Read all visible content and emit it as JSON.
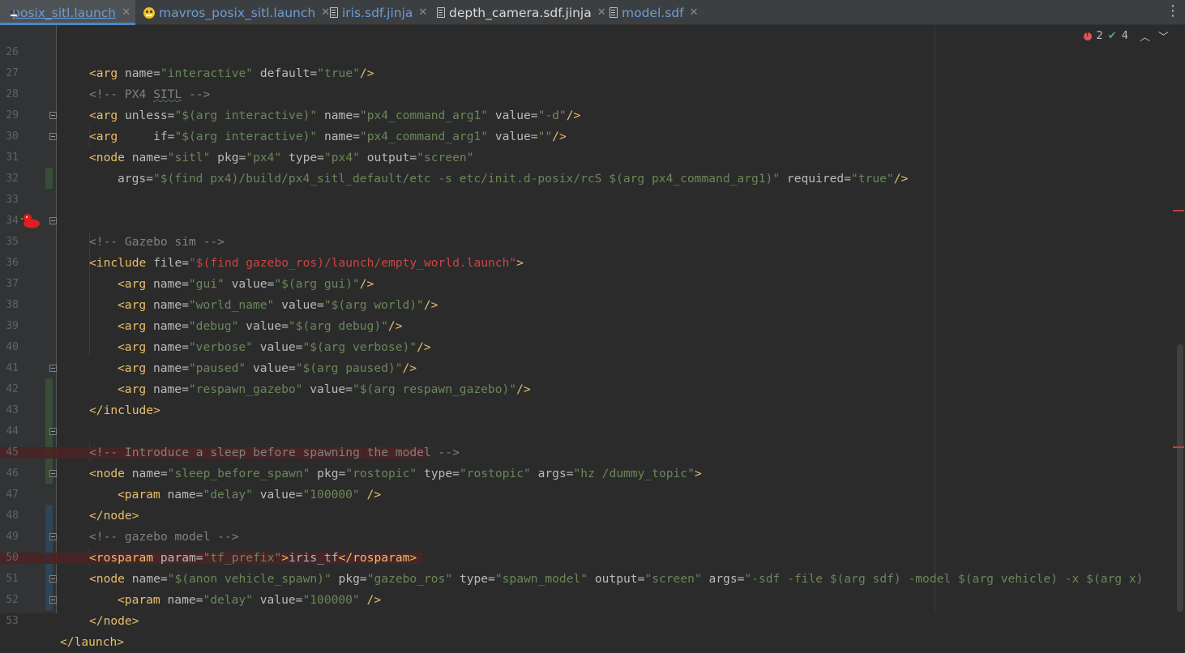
{
  "tabs": [
    {
      "label": "posix_sitl.launch",
      "icon": "ros-icon",
      "active": true
    },
    {
      "label": "mavros_posix_sitl.launch",
      "icon": "ros-icon"
    },
    {
      "label": "iris.sdf.jinja",
      "icon": "file-icon"
    },
    {
      "label": "depth_camera.sdf.jinja",
      "icon": "file-icon"
    },
    {
      "label": "model.sdf",
      "icon": "file-icon"
    }
  ],
  "status": {
    "errors": "2",
    "checks": "4"
  },
  "lines": [
    "26",
    "27",
    "28",
    "29",
    "30",
    "31",
    "32",
    "33",
    "34",
    "35",
    "36",
    "37",
    "38",
    "39",
    "40",
    "41",
    "42",
    "43",
    "44",
    "45",
    "46",
    "47",
    "48",
    "49",
    "50",
    "51",
    "52",
    "53"
  ],
  "code": {
    "l26": {
      "a": "<arg",
      "b": " name=",
      "c": "\"interactive\"",
      "d": " default=",
      "e": "\"true\"",
      "f": "/>"
    },
    "l27": {
      "a": "<!-- PX4 ",
      "b": "SITL",
      "c": " -->"
    },
    "l28": {
      "a": "<arg",
      "b": " unless=",
      "c": "\"$(arg interactive)\"",
      "d": " name=",
      "e": "\"px4_command_arg1\"",
      "f": " value=",
      "g": "\"-d\"",
      "h": "/>"
    },
    "l29": {
      "a": "<arg",
      "b": "     if=",
      "c": "\"$(arg interactive)\"",
      "d": " name=",
      "e": "\"px4_command_arg1\"",
      "f": " value=",
      "g": "\"\"",
      "h": "/>"
    },
    "l30": {
      "a": "<node",
      "b": " name=",
      "c": "\"sitl\"",
      "d": " pkg=",
      "e": "\"px4\"",
      "f": " type=",
      "g": "\"px4\"",
      "h": " output=",
      "i": "\"screen\""
    },
    "l31": {
      "a": "args=",
      "b": "\"$(find px4)/build/px4_sitl_default/etc -s etc/init.d-posix/rcS $(arg px4_command_arg1)\"",
      "c": " required=",
      "d": "\"true\"",
      "e": "/>"
    },
    "l34": {
      "a": "<!-- Gazebo sim -->"
    },
    "l35": {
      "a": "<include",
      "b": " file=",
      "c": "\"$(find gazebo_ros)/launch/empty_world.launch\"",
      "d": ">"
    },
    "l36": {
      "a": "<arg",
      "b": " name=",
      "c": "\"gui\"",
      "d": " value=",
      "e": "\"$(arg gui)\"",
      "f": "/>"
    },
    "l37": {
      "a": "<arg",
      "b": " name=",
      "c": "\"world_name\"",
      "d": " value=",
      "e": "\"$(arg world)\"",
      "f": "/>"
    },
    "l38": {
      "a": "<arg",
      "b": " name=",
      "c": "\"debug\"",
      "d": " value=",
      "e": "\"$(arg debug)\"",
      "f": "/>"
    },
    "l39": {
      "a": "<arg",
      "b": " name=",
      "c": "\"verbose\"",
      "d": " value=",
      "e": "\"$(arg verbose)\"",
      "f": "/>"
    },
    "l40": {
      "a": "<arg",
      "b": " name=",
      "c": "\"paused\"",
      "d": " value=",
      "e": "\"$(arg paused)\"",
      "f": "/>"
    },
    "l41": {
      "a": "<arg",
      "b": " name=",
      "c": "\"respawn_gazebo\"",
      "d": " value=",
      "e": "\"$(arg respawn_gazebo)\"",
      "f": "/>"
    },
    "l42": {
      "a": "</include>"
    },
    "l44": {
      "a": "<!-- Introduce a sleep before spawning the model -->"
    },
    "l45": {
      "a": "<node",
      "b": " name=",
      "c": "\"sleep_before_spawn\"",
      "d": " pkg=",
      "e": "\"rostopic\"",
      "f": " type=",
      "g": "\"rostopic\"",
      "h": " args=",
      "i": "\"hz /dummy_topic\"",
      "j": ">"
    },
    "l46": {
      "a": "<param",
      "b": " name=",
      "c": "\"delay\"",
      "d": " value=",
      "e": "\"100000\"",
      "f": " />"
    },
    "l47": {
      "a": "</node>"
    },
    "l48": {
      "a": "<!-- gazebo model -->"
    },
    "l49": {
      "a": "<rosparam",
      "b": " param=",
      "c": "\"tf_prefix\"",
      "d": ">",
      "e": "iris_tf",
      "f": "</rosparam>"
    },
    "l50": {
      "a": "<node",
      "b": " name=",
      "c": "\"$(anon vehicle_spawn)\"",
      "d": " pkg=",
      "e": "\"gazebo_ros\"",
      "f": " type=",
      "g": "\"spawn_model\"",
      "h": " output=",
      "i": "\"screen\"",
      "j": " args=",
      "k": "\"-sdf -file $(arg sdf) -model $(arg vehicle) -x $(arg x)"
    },
    "l51": {
      "a": "<param",
      "b": " name=",
      "c": "\"delay\"",
      "d": " value=",
      "e": "\"100000\"",
      "f": " />"
    },
    "l52": {
      "a": "</node>"
    },
    "l53": {
      "a": "</launch>"
    }
  },
  "colors": {
    "tag": "#e8bf6a",
    "attr": "#bababa",
    "string": "#6a8759",
    "comment": "#808080",
    "background": "#2b2b2b"
  }
}
